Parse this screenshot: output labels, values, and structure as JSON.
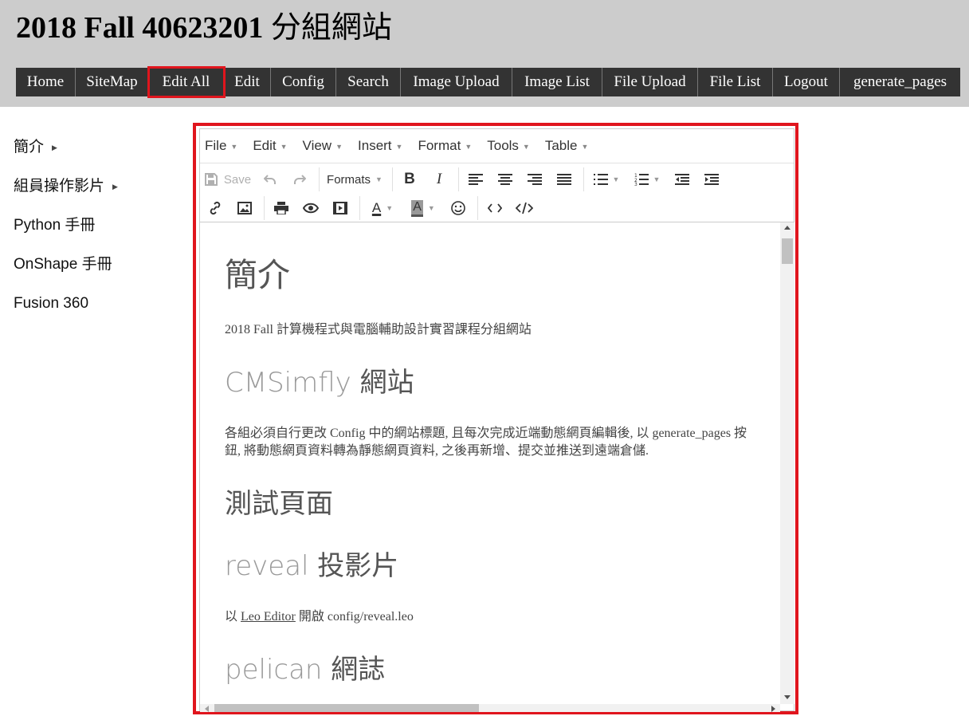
{
  "site": {
    "title_latin": "2018 Fall 40623201",
    "title_cjk": "分組網站"
  },
  "nav": {
    "items": [
      {
        "label": "Home"
      },
      {
        "label": "SiteMap"
      },
      {
        "label": "Edit All"
      },
      {
        "label": "Edit"
      },
      {
        "label": "Config"
      },
      {
        "label": "Search"
      },
      {
        "label": "Image Upload"
      },
      {
        "label": "Image List"
      },
      {
        "label": "File Upload"
      },
      {
        "label": "File List"
      },
      {
        "label": "Logout"
      },
      {
        "label": "generate_pages"
      }
    ],
    "highlighted": "Edit All"
  },
  "sidebar": {
    "items": [
      {
        "label": "簡介",
        "has_submenu": true
      },
      {
        "label": "組員操作影片",
        "has_submenu": true
      },
      {
        "label": "Python 手冊",
        "has_submenu": false
      },
      {
        "label": "OnShape 手冊",
        "has_submenu": false
      },
      {
        "label": "Fusion 360",
        "has_submenu": false
      }
    ]
  },
  "editor": {
    "menubar": [
      "File",
      "Edit",
      "View",
      "Insert",
      "Format",
      "Tools",
      "Table"
    ],
    "toolbar": {
      "save_label": "Save",
      "formats_label": "Formats",
      "row1_icons": [
        "save-icon",
        "undo-icon",
        "redo-icon",
        "formats-dropdown",
        "bold-icon",
        "italic-icon",
        "align-left-icon",
        "align-center-icon",
        "align-right-icon",
        "align-justify-icon",
        "bullet-list-icon",
        "numbered-list-icon",
        "outdent-icon",
        "indent-icon"
      ],
      "row2_icons": [
        "link-icon",
        "image-icon",
        "print-icon",
        "preview-icon",
        "media-icon",
        "text-color-icon",
        "background-color-icon",
        "emoticons-icon",
        "code-icon",
        "source-code-icon"
      ]
    },
    "content": {
      "heading1": "簡介",
      "intro": "2018 Fall 計算機程式與電腦輔助設計實習課程分組網站",
      "cms_heading_latin": "CMSimfly",
      "cms_heading_cjk": "網站",
      "cms_paragraph": "各組必須自行更改 Config 中的網站標題, 且每次完成近端動態網頁編輯後, 以 generate_pages 按鈕, 將動態網頁資料轉為靜態網頁資料, 之後再新增、提交並推送到遠端倉儲.",
      "test_heading": "測試頁面",
      "reveal_heading_latin": "reveal",
      "reveal_heading_cjk": "投影片",
      "reveal_prefix": "以",
      "reveal_link": "Leo Editor",
      "reveal_suffix": "開啟 config/reveal.leo",
      "pelican_heading_latin": "pelican",
      "pelican_heading_cjk": "網誌"
    }
  },
  "colors": {
    "header_bg": "#cccccc",
    "nav_bg": "#333333",
    "highlight": "#e0151d"
  }
}
